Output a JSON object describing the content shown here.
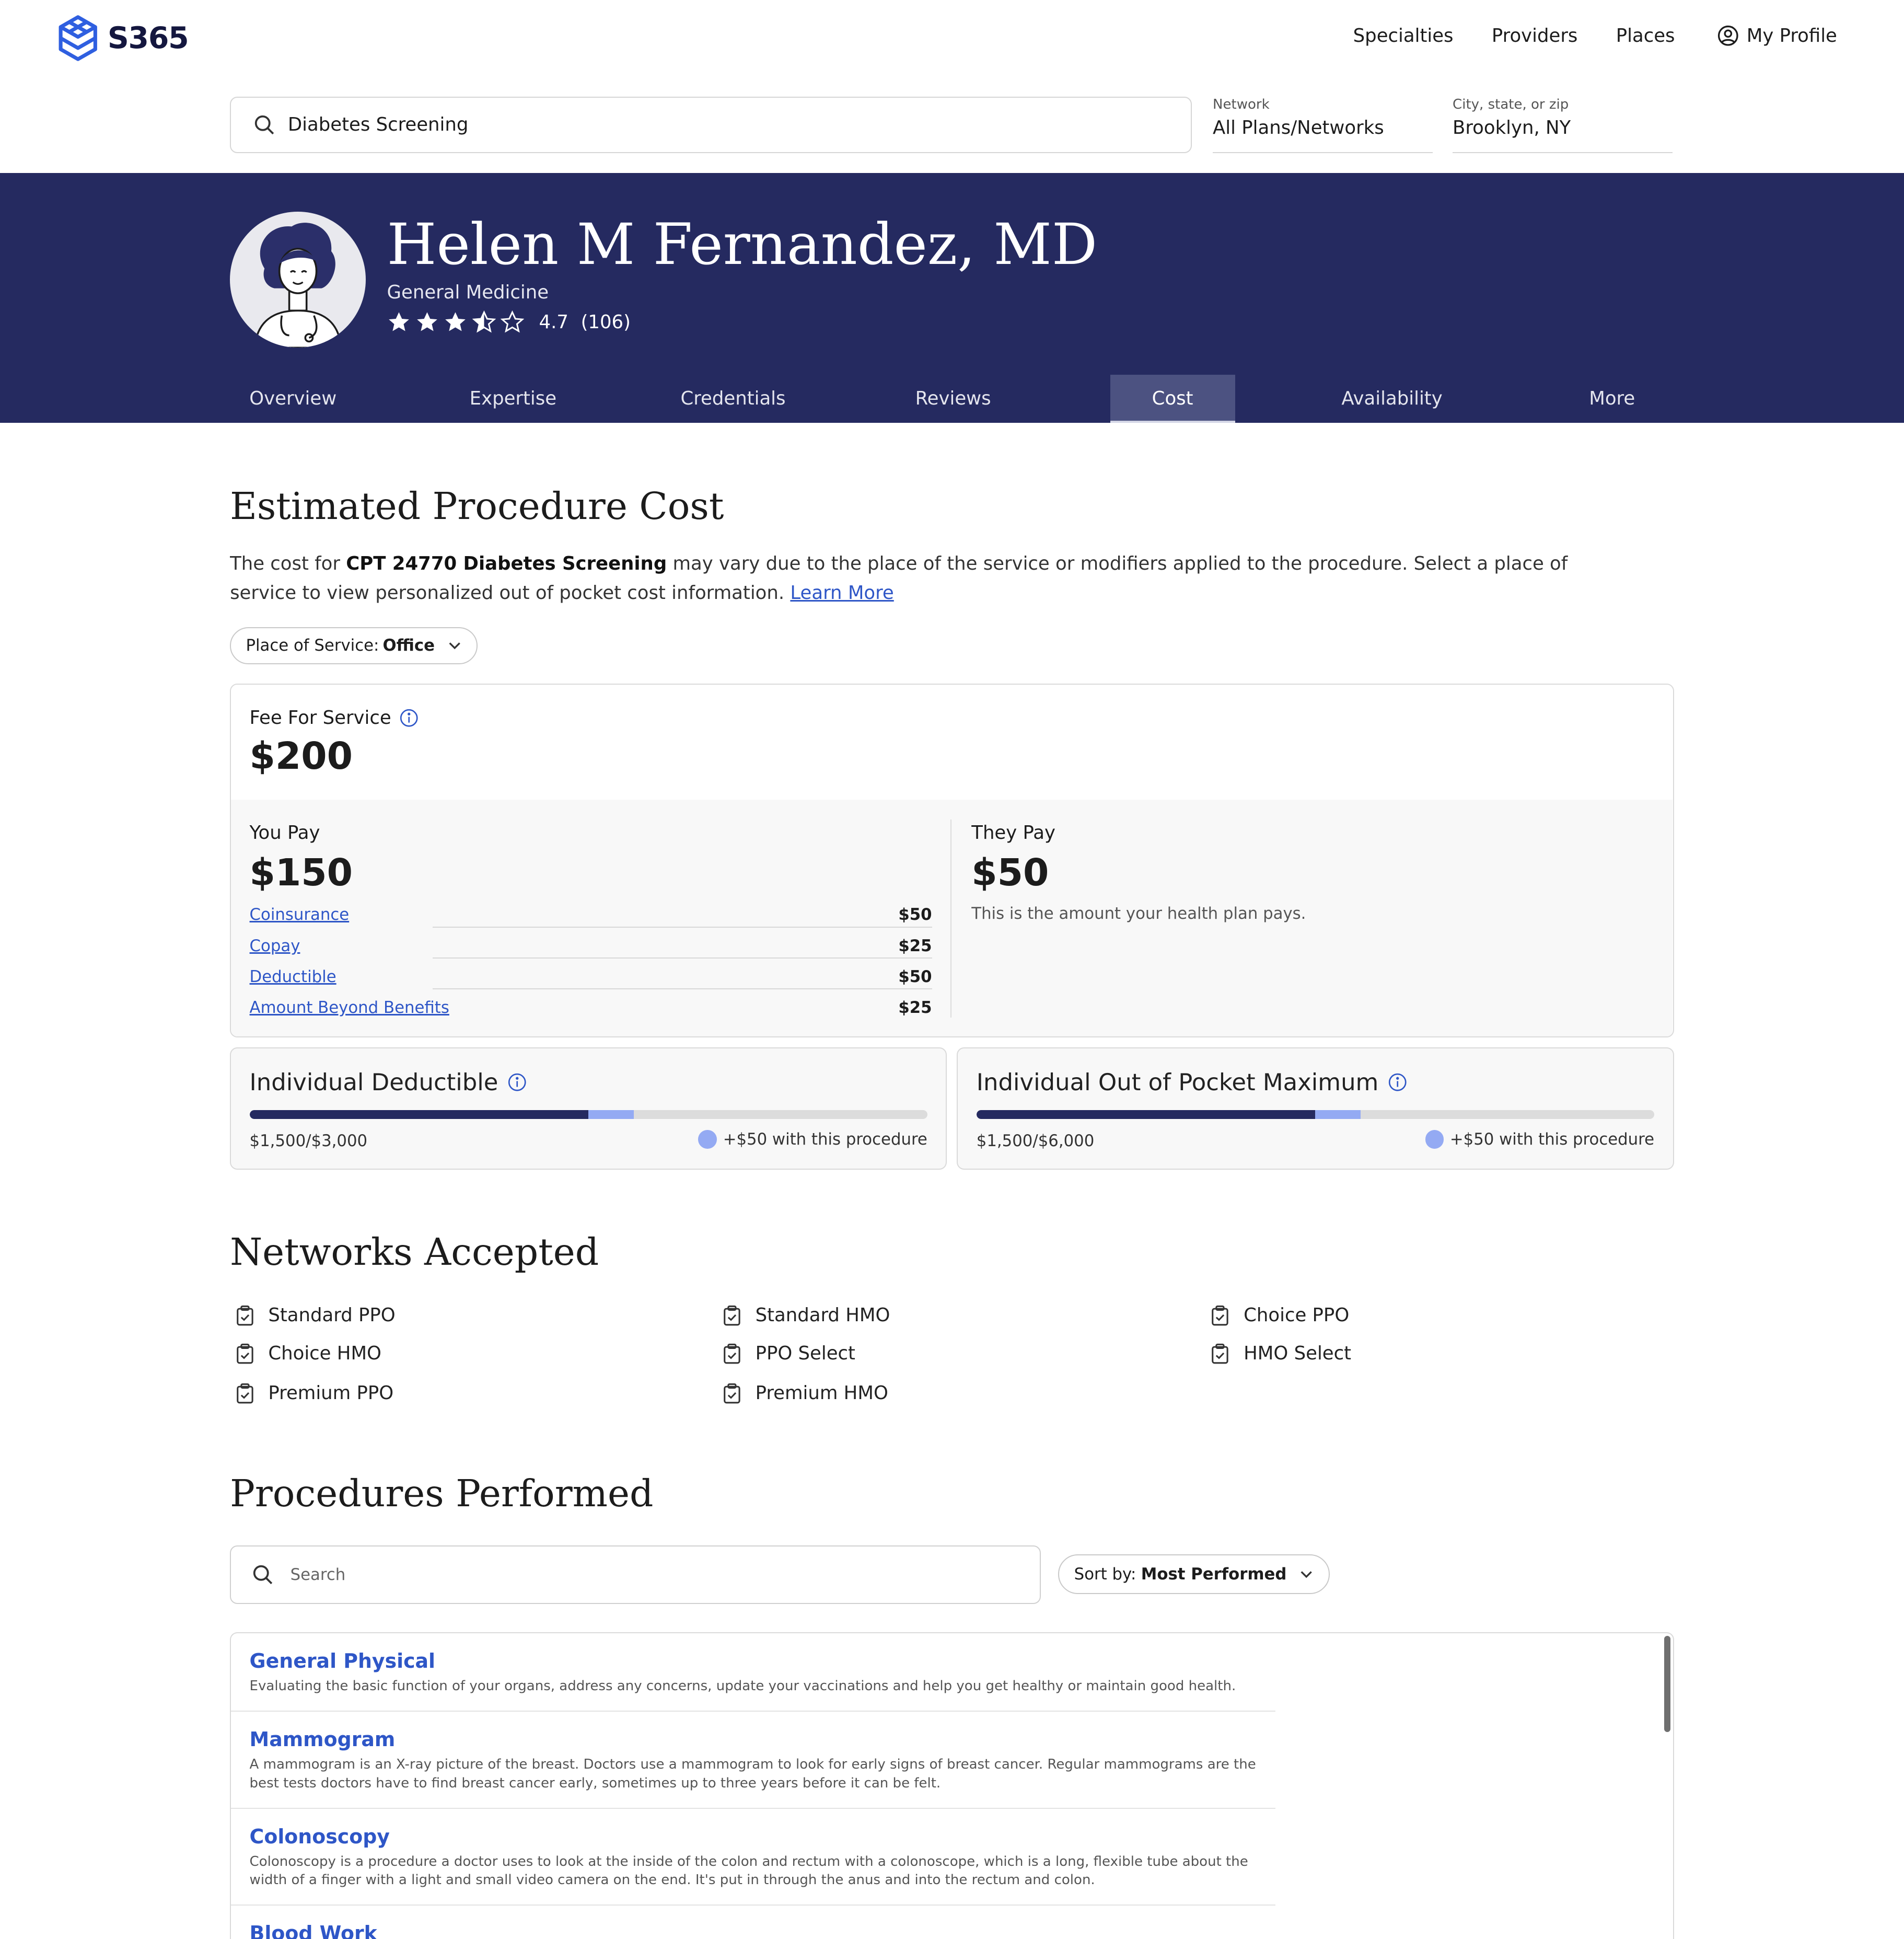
{
  "app": {
    "brand": "S365"
  },
  "topnav": {
    "items": [
      "Specialties",
      "Providers",
      "Places"
    ],
    "profile_label": "My Profile"
  },
  "search": {
    "query": "Diabetes Screening"
  },
  "filters": {
    "network": {
      "label": "Network",
      "value": "All Plans/Networks"
    },
    "location": {
      "label": "City, state, or zip",
      "value": "Brooklyn, NY"
    }
  },
  "provider": {
    "name": "Helen M Fernandez, MD",
    "specialty": "General Medicine",
    "rating": 4.7,
    "rating_text": "4.7",
    "review_count": "(106)"
  },
  "tabs": [
    "Overview",
    "Expertise",
    "Credentials",
    "Reviews",
    "Cost",
    "Availability",
    "More"
  ],
  "active_tab": "Cost",
  "cost": {
    "title": "Estimated Procedure Cost",
    "desc_prefix": "The cost for ",
    "desc_bold": "CPT 24770 Diabetes Screening",
    "desc_suffix": " may vary due to the place of the service or modifiers applied to the procedure. Select a place of service to view personalized out of pocket cost information. ",
    "learn_more": "Learn More",
    "place_label": "Place of Service:",
    "place_value": "Office",
    "fee_label": "Fee For Service",
    "fee_value": "$200",
    "you_pay_label": "You Pay",
    "you_pay_value": "$150",
    "breakdown": [
      {
        "label": "Coinsurance",
        "value": "$50"
      },
      {
        "label": "Copay",
        "value": "$25"
      },
      {
        "label": "Deductible",
        "value": "$50"
      },
      {
        "label": "Amount Beyond Benefits",
        "value": "$25"
      }
    ],
    "they_pay_label": "They Pay",
    "they_pay_value": "$50",
    "they_pay_note": "This is the amount your health plan pays."
  },
  "meters": [
    {
      "title": "Individual Deductible",
      "amount": "$1,500/$3,000",
      "filled_fraction": 0.5,
      "added_fraction": 0.0667,
      "legend": "+$50 with this procedure"
    },
    {
      "title": "Individual Out of Pocket Maximum",
      "amount": "$1,500/$6,000",
      "filled_fraction": 0.5,
      "added_fraction": 0.0667,
      "legend": "+$50 with this procedure"
    }
  ],
  "networks": {
    "title": "Networks Accepted",
    "items": [
      "Standard PPO",
      "Choice HMO",
      "Premium PPO",
      "Standard HMO",
      "PPO Select",
      "Premium HMO",
      "Choice PPO",
      "HMO Select"
    ]
  },
  "procedures": {
    "title": "Procedures Performed",
    "search_placeholder": "Search",
    "sort_label": "Sort by:",
    "sort_value": "Most Performed",
    "items": [
      {
        "name": "General Physical",
        "desc": "Evaluating the basic function of your organs, address any concerns, update your vaccinations and help you get healthy or maintain good health."
      },
      {
        "name": "Mammogram",
        "desc": "A mammogram is an X-ray picture of the breast. Doctors use a mammogram to look for early signs of breast cancer. Regular mammograms are the best tests doctors have to find breast cancer early, sometimes up to three years before it can be felt."
      },
      {
        "name": "Colonoscopy",
        "desc": "Colonoscopy is a procedure a doctor uses to look at the inside of the colon and rectum with a colonoscope, which is a long, flexible tube about the width of a finger with a light and small video camera on the end. It's put in through the anus and into the rectum and colon."
      },
      {
        "name": "Blood Work",
        "desc": ""
      }
    ]
  },
  "colors": {
    "navy": "#252a60",
    "link": "#2e56c7",
    "accent_light": "#94aaf3"
  }
}
